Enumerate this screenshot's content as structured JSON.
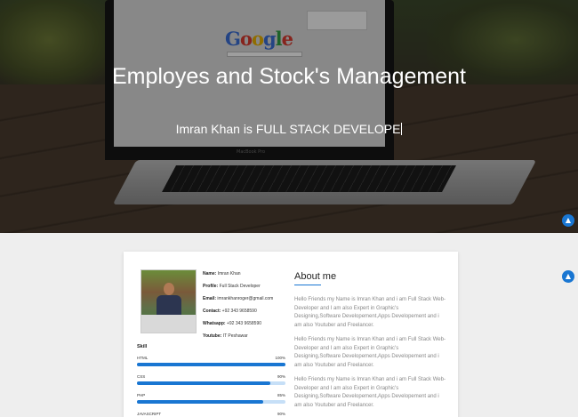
{
  "hero": {
    "title": "Employes and Stock's Management",
    "subtitle": "Imran Khan is FULL STACK DEVELOPE",
    "screen_logo": "Google",
    "laptop_brand": "MacBook Pro"
  },
  "scroll_top_icon": "arrow-up-icon",
  "accent_color": "#1976d2",
  "profile": {
    "rows": [
      {
        "label": "Name:",
        "value": "Imran Khan"
      },
      {
        "label": "Profile:",
        "value": "Full Stack Developer"
      },
      {
        "label": "Email:",
        "value": "imrankhanroger@gmail.com"
      },
      {
        "label": "Contact:",
        "value": "+92 343 9658590"
      },
      {
        "label": "Whatsapp:",
        "value": "+92 343 9658590"
      },
      {
        "label": "Youtube:",
        "value": "IT Peshawar"
      }
    ]
  },
  "skills": {
    "title": "Skill",
    "items": [
      {
        "name": "HTML",
        "percent_label": "100%",
        "level": 1.0
      },
      {
        "name": "CSS",
        "percent_label": "90%",
        "level": 0.9
      },
      {
        "name": "PHP",
        "percent_label": "85%",
        "level": 0.85
      },
      {
        "name": "JAVASCRIPT",
        "percent_label": "90%",
        "level": 0.9
      }
    ]
  },
  "about": {
    "title": "About me",
    "paragraphs": [
      "Hello Friends my Name is Imran Khan and i am Full Stack Web-Developer and I am also Expert in Graphic's Designing,Software Developement,Apps Developement and i am also Youtuber and Freelancer.",
      "Hello Friends my Name is Imran Khan and i am Full Stack Web-Developer and I am also Expert in Graphic's Designing,Software Developement,Apps Developement and i am also Youtuber and Freelancer.",
      "Hello Friends my Name is Imran Khan and i am Full Stack Web-Developer and I am also Expert in Graphic's Designing,Software Developement,Apps Developement and i am also Youtuber and Freelancer."
    ]
  }
}
